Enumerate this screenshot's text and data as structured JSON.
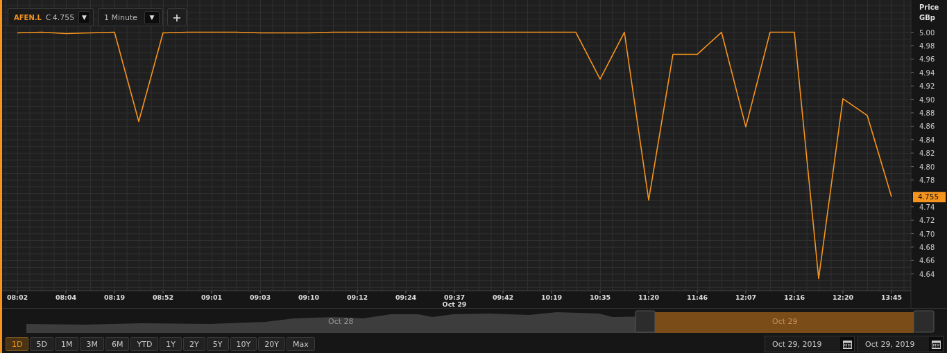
{
  "toolbar": {
    "close_label": "C",
    "close_value": "4.755",
    "symbol_caret": "▼",
    "interval": "1 Minute",
    "interval_caret": "▼",
    "add_button": "+"
  },
  "chart": {
    "current_price": "4.755",
    "chart_data": {
      "type": "line",
      "ylabel": "Price GBp",
      "grid": true,
      "ylim": [
        4.615,
        5.048
      ],
      "categories": [
        "08:02",
        null,
        "08:04",
        null,
        "08:19",
        null,
        "08:52",
        null,
        "09:01",
        null,
        "09:03",
        null,
        "09:10",
        null,
        "09:12",
        null,
        "09:24",
        null,
        "09:37",
        null,
        "09:42",
        null,
        "10:19",
        null,
        "10:35",
        null,
        "11:20",
        null,
        "11:46",
        null,
        "12:07",
        null,
        "12:16",
        null,
        "12:20",
        null,
        "13:45"
      ],
      "yticks": [
        {
          "value": 5.0,
          "label": "5.00"
        },
        {
          "value": 4.98,
          "label": "4.98"
        },
        {
          "value": 4.96,
          "label": "4.96"
        },
        {
          "value": 4.94,
          "label": "4.94"
        },
        {
          "value": 4.92,
          "label": "4.92"
        },
        {
          "value": 4.9,
          "label": "4.90"
        },
        {
          "value": 4.88,
          "label": "4.88"
        },
        {
          "value": 4.86,
          "label": "4.86"
        },
        {
          "value": 4.84,
          "label": "4.84"
        },
        {
          "value": 4.82,
          "label": "4.82"
        },
        {
          "value": 4.8,
          "label": "4.80"
        },
        {
          "value": 4.78,
          "label": "4.78"
        },
        {
          "value": 4.74,
          "label": "4.74"
        },
        {
          "value": 4.72,
          "label": "4.72"
        },
        {
          "value": 4.7,
          "label": "4.70"
        },
        {
          "value": 4.68,
          "label": "4.68"
        },
        {
          "value": 4.66,
          "label": "4.66"
        },
        {
          "value": 4.64,
          "label": "4.64"
        }
      ],
      "annotations": [
        "Oct 29"
      ],
      "series": [
        {
          "name": "AFEN.L",
          "color": "#f7941d",
          "values": [
            4.999,
            5.0,
            4.998,
            4.999,
            5.0,
            4.867,
            4.999,
            5.0,
            5.0,
            5.0,
            4.999,
            4.999,
            4.999,
            5.0,
            5.0,
            5.0,
            5.0,
            5.0,
            5.0,
            5.0,
            5.0,
            5.0,
            5.0,
            5.0,
            4.93,
            5.0,
            4.75,
            4.967,
            4.967,
            5.0,
            4.859,
            5.0,
            5.0,
            4.633,
            4.901,
            4.876,
            4.755
          ]
        }
      ]
    }
  },
  "navigator": {
    "labels": [
      "Oct 28",
      "Oct 29"
    ]
  },
  "ranges": [
    {
      "label": "1D",
      "selected": true
    },
    {
      "label": "5D",
      "selected": false
    },
    {
      "label": "1M",
      "selected": false
    },
    {
      "label": "3M",
      "selected": false
    },
    {
      "label": "6M",
      "selected": false
    },
    {
      "label": "YTD",
      "selected": false
    },
    {
      "label": "1Y",
      "selected": false
    },
    {
      "label": "2Y",
      "selected": false
    },
    {
      "label": "5Y",
      "selected": false
    },
    {
      "label": "10Y",
      "selected": false
    },
    {
      "label": "20Y",
      "selected": false
    },
    {
      "label": "Max",
      "selected": false
    }
  ],
  "date_from": "Oct 29, 2019",
  "date_to": "Oct 29, 2019"
}
